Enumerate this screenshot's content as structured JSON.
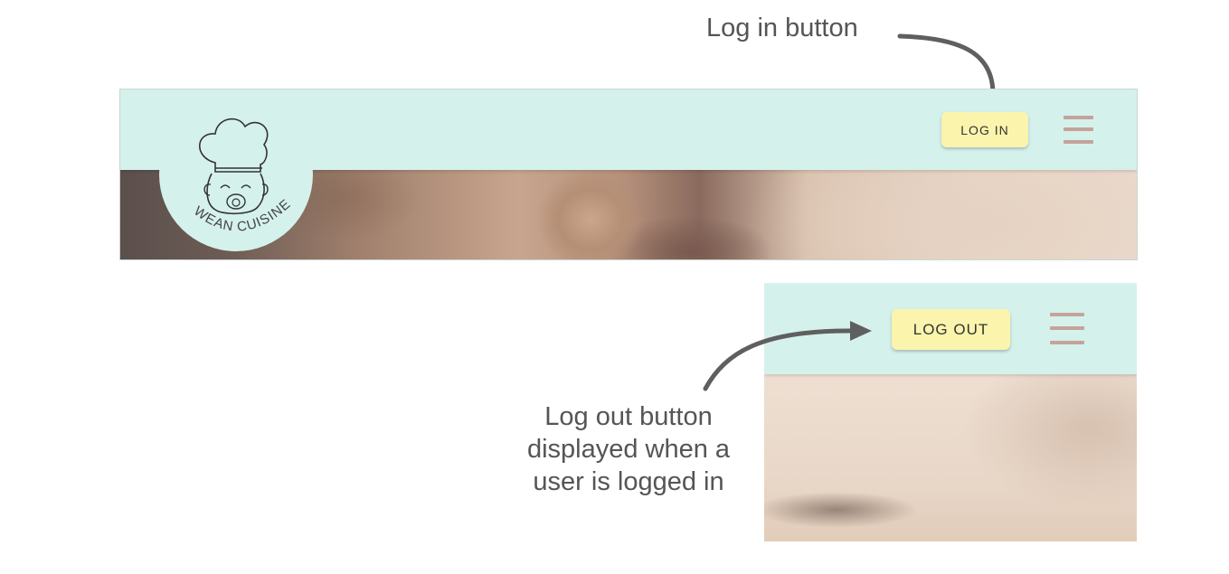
{
  "annotations": {
    "login": "Log in button",
    "logout_lines": [
      "Log out button",
      "displayed when a",
      "user is logged in"
    ]
  },
  "header": {
    "logo_text": "WEAN CUISINE",
    "login_label": "LOG IN",
    "logout_label": "LOG OUT",
    "menu_icon": "hamburger-menu-icon"
  },
  "colors": {
    "header_bg": "#d5f1ec",
    "button_bg": "#fbf4ad",
    "menu_icon": "#c4a39b",
    "annotation_text": "#555555",
    "arrow": "#5f5f5f"
  }
}
